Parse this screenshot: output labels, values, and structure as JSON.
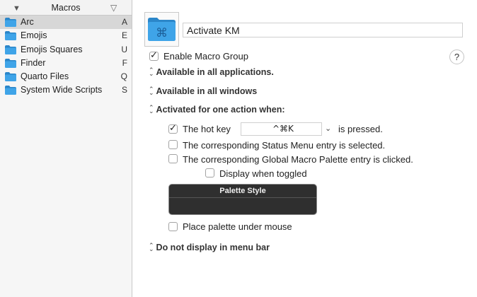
{
  "sidebar": {
    "header_title": "Macros",
    "items": [
      {
        "label": "Arc",
        "key": "A",
        "selected": true
      },
      {
        "label": "Emojis",
        "key": "E"
      },
      {
        "label": "Emojis Squares",
        "key": "U"
      },
      {
        "label": "Finder",
        "key": "F"
      },
      {
        "label": "Quarto Files",
        "key": "Q"
      },
      {
        "label": "System Wide Scripts",
        "key": "S"
      }
    ]
  },
  "group": {
    "name": "Activate KM",
    "enable_label": "Enable Macro Group",
    "help_label": "?",
    "availability": "Available in all applications.",
    "windows": "Available in all windows",
    "activation": "Activated for one action when:",
    "hotkey_label": "The hot key",
    "hotkey_value": "^⌘K",
    "hotkey_suffix": "is pressed.",
    "status_menu_label": "The corresponding Status Menu entry is selected.",
    "global_palette_label": "The corresponding Global Macro Palette entry is clicked.",
    "display_toggled_label": "Display when toggled",
    "palette_style_label": "Palette Style",
    "palette_under_mouse_label": "Place palette under mouse",
    "menu_bar": "Do not display in menu bar"
  },
  "colors": {
    "folder": "#3fa4e8",
    "folder_dark": "#2b86c9",
    "selection": "#d7d7d7"
  }
}
